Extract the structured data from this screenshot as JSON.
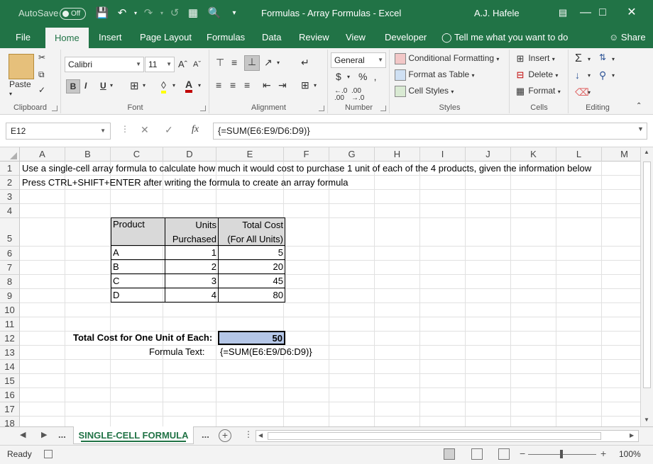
{
  "titlebar": {
    "autosave_label": "AutoSave",
    "autosave_state": "Off",
    "doc_title": "Formulas - Array Formulas  -  Excel",
    "user_name": "A.J. Hafele"
  },
  "tabs": {
    "file": "File",
    "home": "Home",
    "insert": "Insert",
    "page_layout": "Page Layout",
    "formulas": "Formulas",
    "data": "Data",
    "review": "Review",
    "view": "View",
    "developer": "Developer",
    "tell_me": "Tell me what you want to do",
    "share": "Share"
  },
  "ribbon": {
    "clipboard": {
      "label": "Clipboard",
      "paste": "Paste"
    },
    "font": {
      "label": "Font",
      "font_name": "Calibri",
      "font_size": "11",
      "bold": "B",
      "italic": "I",
      "underline": "U"
    },
    "alignment": {
      "label": "Alignment"
    },
    "number": {
      "label": "Number",
      "format": "General",
      "currency": "$",
      "percent": "%"
    },
    "styles": {
      "label": "Styles",
      "conditional_formatting": "Conditional Formatting",
      "format_as_table": "Format as Table",
      "cell_styles": "Cell Styles"
    },
    "cells": {
      "label": "Cells",
      "insert": "Insert",
      "delete": "Delete",
      "format": "Format"
    },
    "editing": {
      "label": "Editing"
    }
  },
  "formula_bar": {
    "name_box": "E12",
    "formula": "{=SUM(E6:E9/D6:D9)}",
    "fx": "fx"
  },
  "grid": {
    "columns": [
      "A",
      "B",
      "C",
      "D",
      "E",
      "F",
      "G",
      "H",
      "I",
      "J",
      "K",
      "L",
      "M"
    ],
    "rows": [
      "1",
      "2",
      "3",
      "4",
      "5",
      "6",
      "7",
      "8",
      "9",
      "10",
      "11",
      "12",
      "13",
      "14",
      "15",
      "16",
      "17",
      "18"
    ],
    "row1_text": "Use a single-cell array formula to calculate how much it would cost to purchase 1 unit of each of the 4 products, given the information below",
    "row2_text": "Press CTRL+SHIFT+ENTER after writing the formula to create an array formula",
    "table": {
      "headers": {
        "product": "Product",
        "units_line1": "Units",
        "units_line2": "Purchased",
        "total_line1": "Total Cost",
        "total_line2": "(For All Units)"
      },
      "rows": [
        {
          "product": "A",
          "units": "1",
          "total": "5"
        },
        {
          "product": "B",
          "units": "2",
          "total": "20"
        },
        {
          "product": "C",
          "units": "3",
          "total": "45"
        },
        {
          "product": "D",
          "units": "4",
          "total": "80"
        }
      ]
    },
    "total_label": "Total Cost for One Unit of Each:",
    "total_value": "50",
    "formula_text_label": "Formula Text:",
    "formula_text_value": "{=SUM(E6:E9/D6:D9)}"
  },
  "sheets": {
    "ellipsis_left": "...",
    "active_sheet": "SINGLE-CELL FORMULA",
    "ellipsis_right": "..."
  },
  "status": {
    "ready": "Ready",
    "zoom": "100%"
  },
  "colors": {
    "excel_green": "#217346",
    "selected_cell_fill": "#b4c6e7",
    "table_header_fill": "#d9d9d9"
  }
}
